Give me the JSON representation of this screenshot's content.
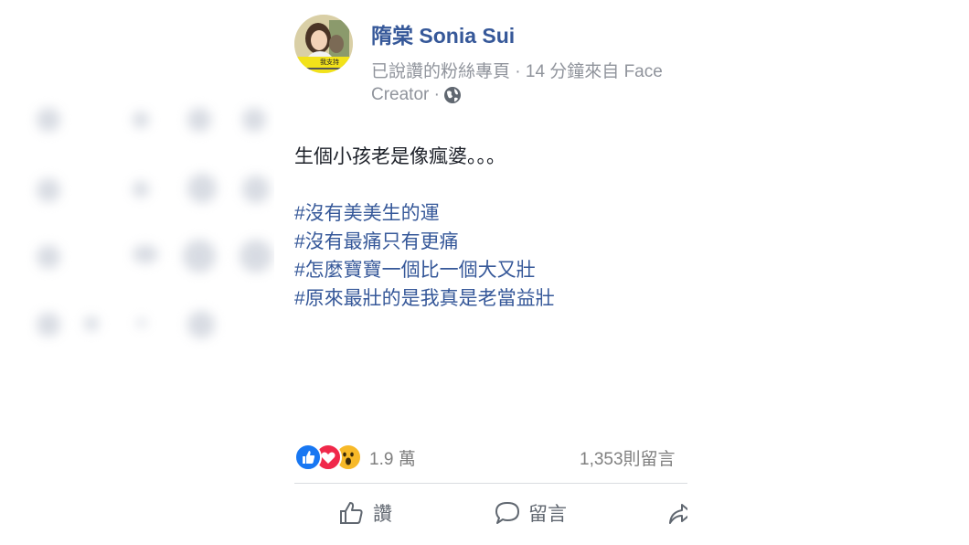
{
  "post": {
    "author": "隋棠 Sonia Sui",
    "meta_line1": "已說讚的粉絲專頁 · 14 分鐘來自 Face",
    "meta_line2": "Creator ·",
    "avatar_banner_text": "我支持",
    "text": "生個小孩老是像瘋婆。。。",
    "hashtags": [
      "#沒有美美生的運",
      "#沒有最痛只有更痛",
      "#怎麼寶寶一個比一個大又壯",
      "#原來最壯的是我真是老當益壯"
    ]
  },
  "stats": {
    "reactions_count": "1.9 萬",
    "comments_count": "1,353則留言"
  },
  "actions": {
    "like_label": "讚",
    "comment_label": "留言"
  },
  "colors": {
    "link": "#365899",
    "muted": "#90949c",
    "like_blue": "#1877f2",
    "love_red": "#f0284a",
    "wow_yellow": "#f7b928"
  },
  "icons": [
    "globe-icon",
    "like-reaction-icon",
    "love-reaction-icon",
    "wow-reaction-icon",
    "thumbs-up-icon",
    "comment-icon",
    "share-icon"
  ]
}
